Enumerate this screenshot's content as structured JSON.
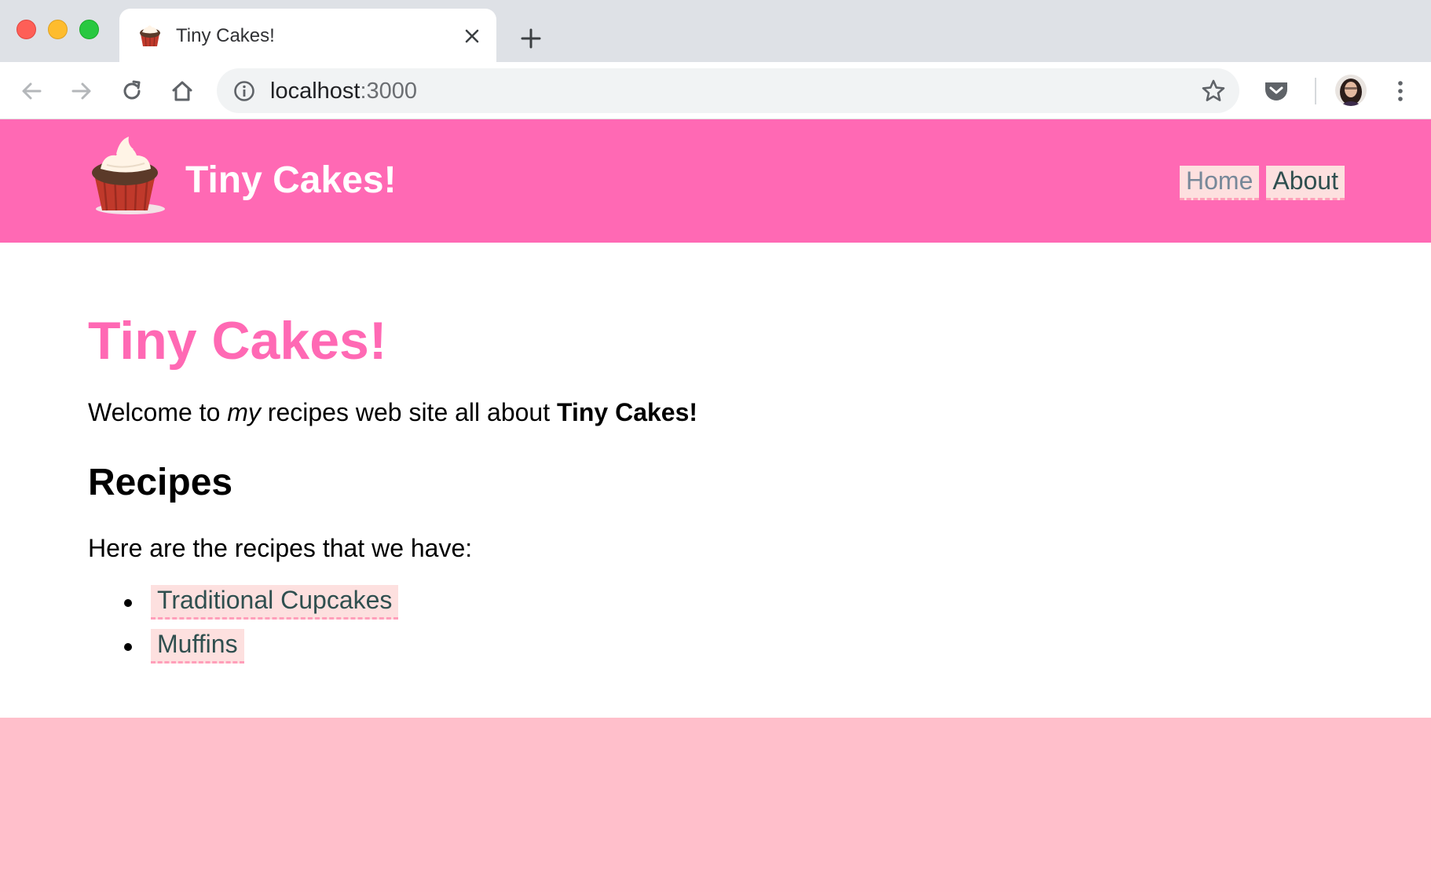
{
  "browser": {
    "tab": {
      "title": "Tiny Cakes!",
      "favicon": "cupcake-icon"
    },
    "address": {
      "host": "localhost",
      "port": ":3000"
    },
    "icons": {
      "back": "arrow-left-icon",
      "forward": "arrow-right-icon",
      "reload": "reload-icon",
      "home": "home-icon",
      "info": "info-icon",
      "bookmark": "star-icon",
      "pocket": "pocket-icon",
      "menu": "kebab-menu-icon"
    }
  },
  "site": {
    "title": "Tiny Cakes!",
    "nav": [
      {
        "label": "Home"
      },
      {
        "label": "About"
      }
    ]
  },
  "content": {
    "heading": "Tiny Cakes!",
    "welcome": {
      "prefix": "Welcome to ",
      "emphasis": "my",
      "middle": " recipes web site all about ",
      "strong": "Tiny Cakes!"
    },
    "recipes_heading": "Recipes",
    "recipes_intro": "Here are the recipes that we have:",
    "recipes": [
      {
        "label": "Traditional Cupcakes"
      },
      {
        "label": "Muffins"
      }
    ]
  },
  "colors": {
    "header": "#ff69b4",
    "footer": "#ffbfcb",
    "heading": "#ff69b4",
    "link_bg": "#fde0df",
    "link_border": "#ff9fba",
    "link_text": "#2f4f4f",
    "visited_text": "#778899"
  }
}
